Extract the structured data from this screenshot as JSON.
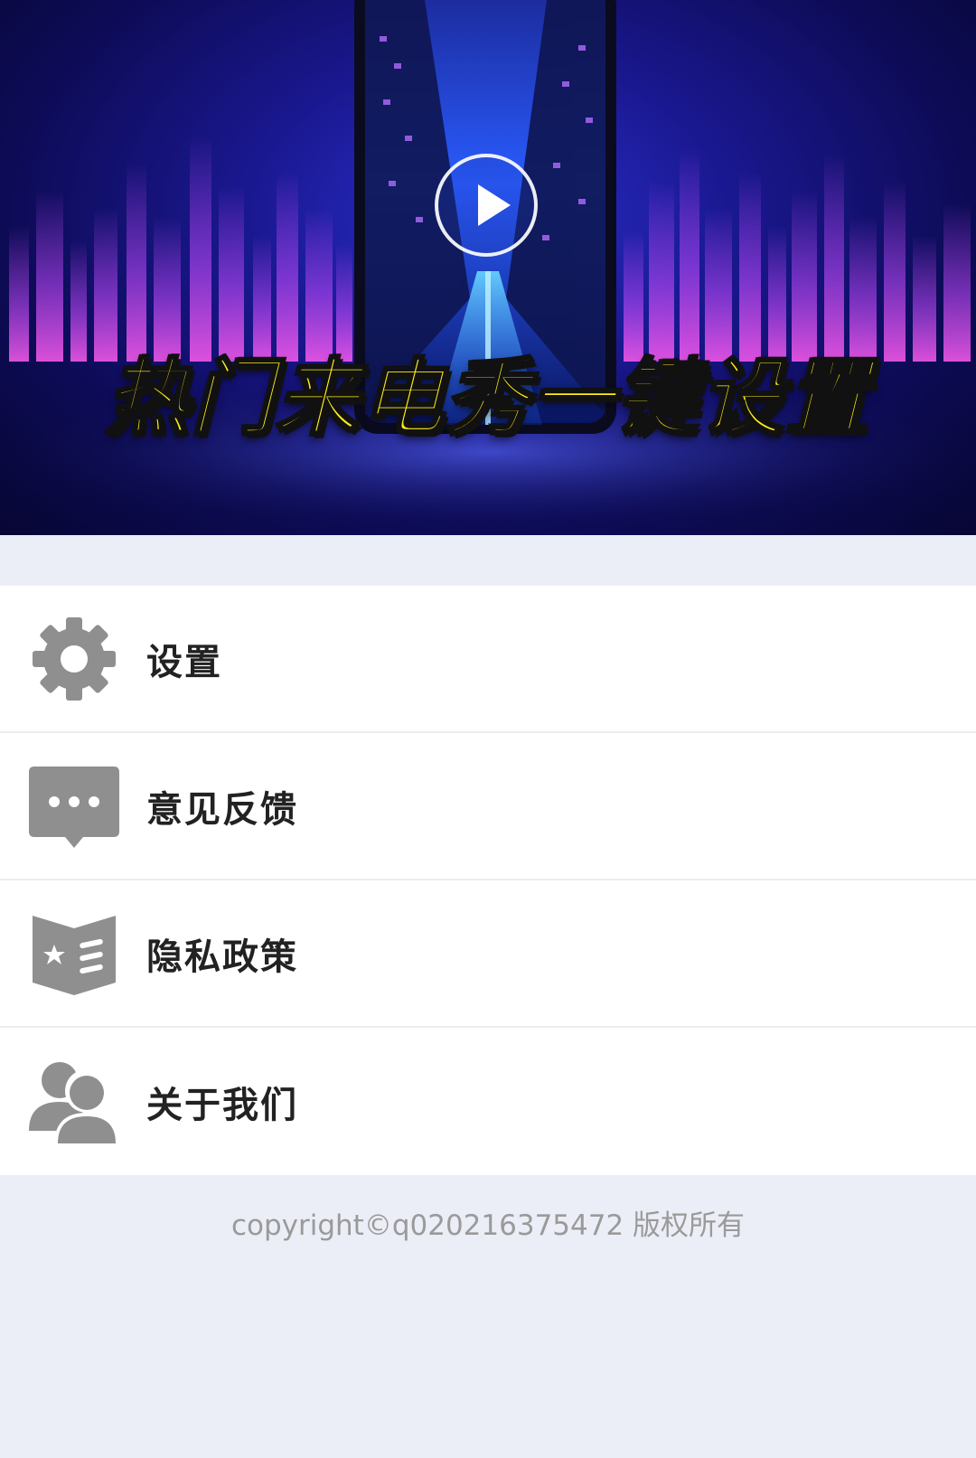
{
  "banner": {
    "title": "热门来电秀一键设置",
    "play_icon": "play-circle-icon"
  },
  "menu": {
    "items": [
      {
        "label": "设置",
        "icon": "gear-icon"
      },
      {
        "label": "意见反馈",
        "icon": "chat-bubble-icon"
      },
      {
        "label": "隐私政策",
        "icon": "policy-book-icon"
      },
      {
        "label": "关于我们",
        "icon": "users-icon"
      }
    ]
  },
  "footer": {
    "copyright": "copyright©q020216375472 版权所有"
  },
  "colors": {
    "page_background": "#eceef7",
    "icon_gray": "#8f8f8f",
    "title_yellow": "#ffee1a"
  }
}
